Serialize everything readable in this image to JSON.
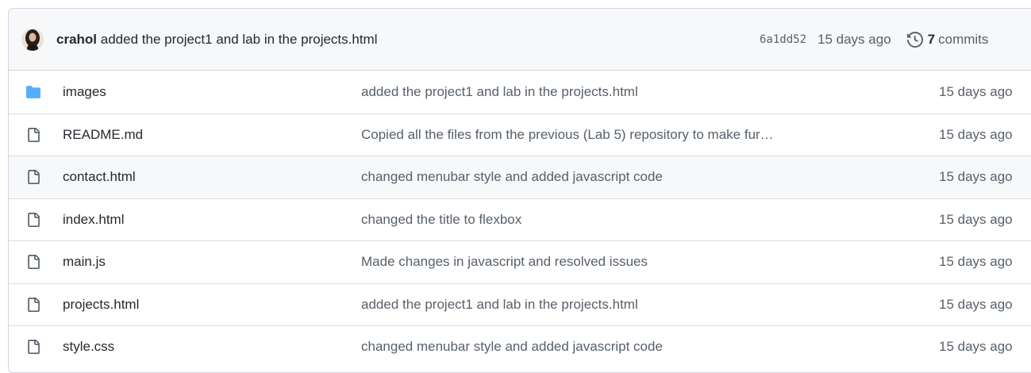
{
  "latest_commit": {
    "author": "crahol",
    "message": "added the project1 and lab in the projects.html",
    "sha": "6a1dd52",
    "age": "15 days ago",
    "commits_count": "7",
    "commits_label": "commits"
  },
  "files": [
    {
      "icon": "folder-icon",
      "name": "images",
      "message": "added the project1 and lab in the projects.html",
      "age": "15 days ago"
    },
    {
      "icon": "file-icon",
      "name": "README.md",
      "message": "Copied all the files from the previous (Lab 5) repository to make fur…",
      "age": "15 days ago"
    },
    {
      "icon": "file-icon",
      "name": "contact.html",
      "message": "changed menubar style and added javascript code",
      "age": "15 days ago"
    },
    {
      "icon": "file-icon",
      "name": "index.html",
      "message": "changed the title to flexbox",
      "age": "15 days ago"
    },
    {
      "icon": "file-icon",
      "name": "main.js",
      "message": "Made changes in javascript and resolved issues",
      "age": "15 days ago"
    },
    {
      "icon": "file-icon",
      "name": "projects.html",
      "message": "added the project1 and lab in the projects.html",
      "age": "15 days ago"
    },
    {
      "icon": "file-icon",
      "name": "style.css",
      "message": "changed menubar style and added javascript code",
      "age": "15 days ago"
    }
  ],
  "colors": {
    "folder": "#54aeff",
    "header_bg": "#f6f8fa",
    "border": "#d0d7de",
    "muted_text": "#57606a"
  }
}
